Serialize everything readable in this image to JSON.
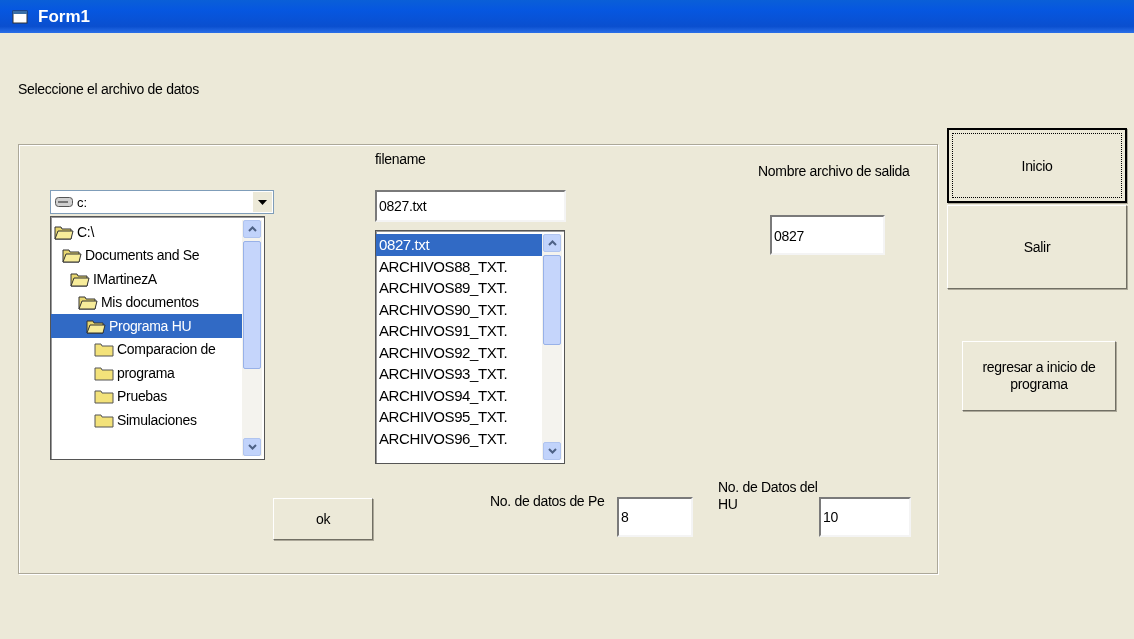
{
  "window": {
    "title": "Form1"
  },
  "select_label": "Seleccione el archivo de datos",
  "drive_combo": {
    "value": "c:"
  },
  "dir_list": {
    "items": [
      {
        "label": "C:\\",
        "expanded": true,
        "selected": false,
        "children": [
          {
            "label": "Documents and Se",
            "expanded": true,
            "selected": false,
            "children": [
              {
                "label": "IMartinezA",
                "expanded": true,
                "selected": false,
                "children": [
                  {
                    "label": "Mis documentos",
                    "expanded": true,
                    "selected": false,
                    "children": [
                      {
                        "label": "Programa HU",
                        "expanded": true,
                        "selected": true,
                        "children": [
                          {
                            "label": "Comparacion de",
                            "expanded": false,
                            "selected": false
                          },
                          {
                            "label": "programa",
                            "expanded": false,
                            "selected": false
                          },
                          {
                            "label": "Pruebas",
                            "expanded": false,
                            "selected": false
                          },
                          {
                            "label": "Simulaciones",
                            "expanded": false,
                            "selected": false
                          }
                        ]
                      }
                    ]
                  }
                ]
              }
            ]
          }
        ]
      }
    ]
  },
  "filename_label": "filename",
  "filename_field": {
    "value": "0827.txt"
  },
  "file_list": {
    "items": [
      {
        "label": "0827.txt",
        "selected": true
      },
      {
        "label": "ARCHIVOS88_TXT.",
        "selected": false
      },
      {
        "label": "ARCHIVOS89_TXT.",
        "selected": false
      },
      {
        "label": "ARCHIVOS90_TXT.",
        "selected": false
      },
      {
        "label": "ARCHIVOS91_TXT.",
        "selected": false
      },
      {
        "label": "ARCHIVOS92_TXT.",
        "selected": false
      },
      {
        "label": "ARCHIVOS93_TXT.",
        "selected": false
      },
      {
        "label": "ARCHIVOS94_TXT.",
        "selected": false
      },
      {
        "label": "ARCHIVOS95_TXT.",
        "selected": false
      },
      {
        "label": "ARCHIVOS96_TXT.",
        "selected": false
      }
    ]
  },
  "output_label": "Nombre archivo de salida",
  "output_field": {
    "value": "0827"
  },
  "ok_button": "ok",
  "pe_label": "No. de datos de Pe",
  "pe_field": {
    "value": "8"
  },
  "hu_label": "No. de Datos del HU",
  "hu_field": {
    "value": "10"
  },
  "buttons": [
    {
      "label": "Inicio",
      "focused": true
    },
    {
      "label": "Salir",
      "focused": false
    },
    {
      "label": "regresar a  inicio de programa",
      "focused": false
    }
  ]
}
